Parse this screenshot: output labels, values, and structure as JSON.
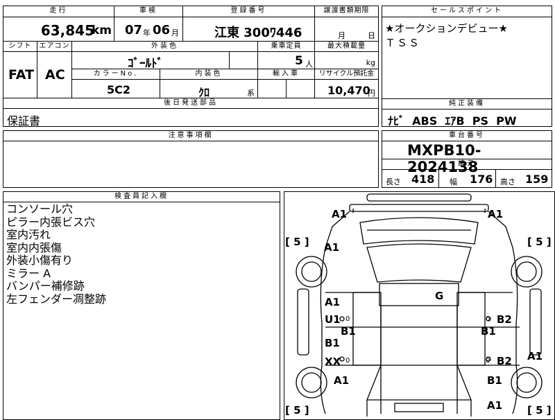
{
  "top_left": {
    "mileage_label": "走行",
    "mileage_value": "63,845",
    "mileage_unit": "km",
    "inspection_label": "車検",
    "inspection_year": "07",
    "inspection_year_unit": "年",
    "inspection_month": "06",
    "inspection_month_unit": "月",
    "plate_label": "登録番号",
    "plate_value": "江東 300ﾜ446",
    "transfer_label": "譲渡書類期限",
    "transfer_month_unit": "月",
    "transfer_day_unit": "日"
  },
  "mid_left": {
    "shift_label": "シフト",
    "shift_value": "FAT",
    "ac_label": "エアコン",
    "ac_value": "AC",
    "ext_color_label": "外装色",
    "ext_color_value": "ｺﾞｰﾙﾄﾞ",
    "capacity_label": "乗車定員",
    "capacity_value": "5",
    "capacity_unit": "人",
    "max_load_label": "最大積載量",
    "max_load_unit": "kg",
    "color_no_label": "カラーNo.",
    "color_no_value": "5C2",
    "int_color_label": "内装色",
    "int_color_value": "ｸﾛ",
    "int_color_suffix": "系",
    "import_label": "輸入車",
    "recycle_label": "リサイクル預託金",
    "recycle_value": "10,470",
    "recycle_unit": "円"
  },
  "parts": {
    "label": "後日発送部品",
    "value": "保証書"
  },
  "caution": {
    "label": "注意事項欄",
    "value": ""
  },
  "sales_point": {
    "label": "セールスポイント",
    "lines": [
      "★オークションデビュー★",
      "ＴＳＳ"
    ]
  },
  "equipment": {
    "label": "純正装備",
    "value": "ﾅﾋﾞ  ABS  ｴｱB  PS  PW"
  },
  "chassis": {
    "label": "車台番号",
    "value": "MXPB10-2024138"
  },
  "specs": {
    "label": "諸元",
    "length_label": "長さ",
    "length_value": "418",
    "width_label": "幅",
    "width_value": "176",
    "height_label": "高さ",
    "height_value": "159"
  },
  "inspector": {
    "label": "検査員記入欄",
    "notes": [
      "コンソール穴",
      "ピラー内張ビス穴",
      "室内汚れ",
      "室内内張傷",
      "外装小傷有り",
      "ミラー A",
      "バンパー補修跡",
      "左フェンダー凋整跡"
    ]
  },
  "diagram": {
    "marks": {
      "fl_corner": "A1",
      "fr_corner": "A1",
      "left_front_fender": "A1",
      "left_front_door_a": "A1",
      "left_front_door_u": "U1",
      "left_b_mid": "B1",
      "left_rear_door_b": "B1",
      "left_rear_door_xx": "XX",
      "left_rear_fender": "A1",
      "roof": "G",
      "right_b_mid": "B1",
      "right_front_door": "B2",
      "right_rear_door": "B2",
      "right_rear_fender": "B1",
      "right_side": "A1",
      "rear_corner": "A1"
    },
    "tyres": {
      "front_left": "5",
      "front_right": "5",
      "rear_left": "5",
      "rear_right": "5"
    },
    "small_circle": "0"
  }
}
